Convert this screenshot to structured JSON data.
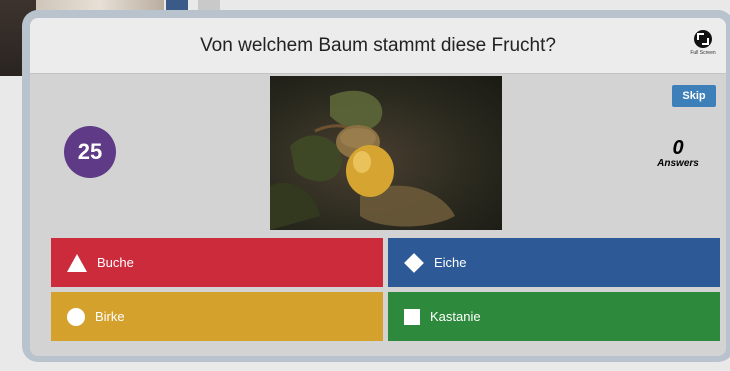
{
  "quiz": {
    "question": "Von welchem Baum stammt diese Frucht?",
    "fullscreen_label": "Full Screen",
    "timer": "25",
    "skip_label": "Skip",
    "answers_count": "0",
    "answers_label": "Answers",
    "options": [
      {
        "label": "Buche",
        "shape": "triangle-icon",
        "color": "#cc2b3c"
      },
      {
        "label": "Eiche",
        "shape": "diamond-icon",
        "color": "#2d5a96"
      },
      {
        "label": "Birke",
        "shape": "circle-icon",
        "color": "#d4a12c"
      },
      {
        "label": "Kastanie",
        "shape": "square-icon",
        "color": "#2d8a3c"
      }
    ]
  },
  "colors": {
    "timer_purple": "#5f3a86",
    "skip_blue": "#3d7fb8"
  }
}
